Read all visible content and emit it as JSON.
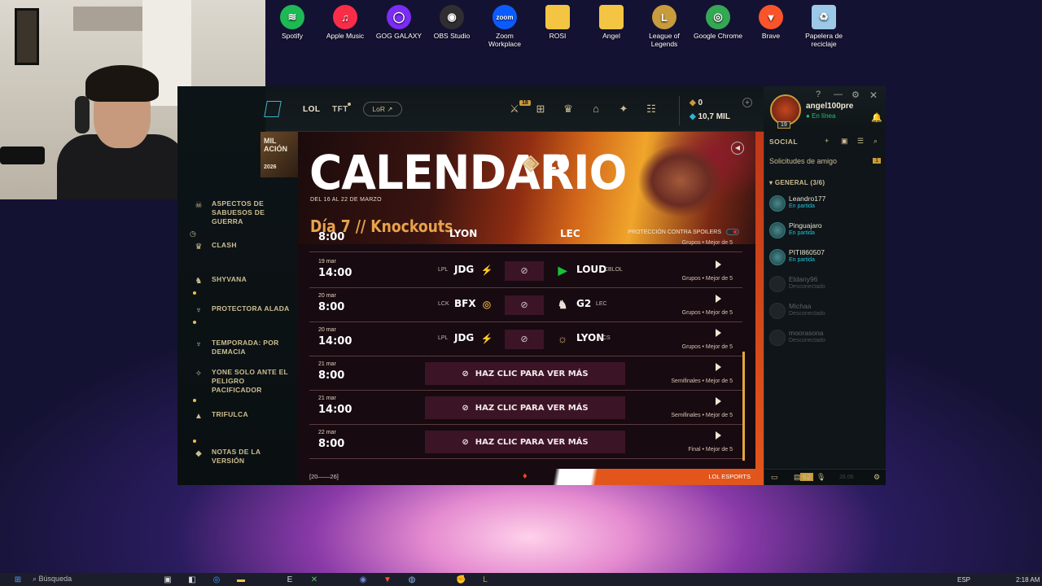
{
  "desktop_icons": [
    {
      "label": "Spotify",
      "icon": "spotify-icon",
      "color": "#1db954",
      "glyph": "≋"
    },
    {
      "label": "Apple Music",
      "icon": "apple-music-icon",
      "color": "#fa2d48",
      "glyph": "♫"
    },
    {
      "label": "GOG GALAXY",
      "icon": "gog-galaxy-icon",
      "color": "#7b2cf5",
      "glyph": "◯"
    },
    {
      "label": "OBS Studio",
      "icon": "obs-studio-icon",
      "color": "#302e31",
      "glyph": "◉"
    },
    {
      "label": "Zoom Workplace",
      "icon": "zoom-icon",
      "color": "#0b5cff",
      "glyph": "zoom"
    },
    {
      "label": "ROSI",
      "icon": "folder-icon",
      "color": "#f4c542",
      "glyph": ""
    },
    {
      "label": "Angel",
      "icon": "folder-icon",
      "color": "#f4c542",
      "glyph": ""
    },
    {
      "label": "League of\nLegends",
      "icon": "league-of-legends-icon",
      "color": "#c89b3c",
      "glyph": "L"
    },
    {
      "label": "Google Chrome",
      "icon": "chrome-icon",
      "color": "#34a853",
      "glyph": "◎"
    },
    {
      "label": "Brave",
      "icon": "brave-icon",
      "color": "#fb542b",
      "glyph": "▼"
    },
    {
      "label": "Papelera de\nreciclaje",
      "icon": "recycle-bin-icon",
      "color": "#9cc9e8",
      "glyph": "♻"
    }
  ],
  "topbar": {
    "lol": "LOL",
    "tft": "TFT",
    "lor": "LoR",
    "store_badge": "18",
    "rp": "0",
    "be": "10,7 MIL"
  },
  "profile": {
    "name": "angel100pre",
    "status": "En línea",
    "level": "19"
  },
  "left_nav": {
    "header_fragment": "MIL",
    "header_fragment2": "ACIÓN",
    "year": "2026",
    "items": [
      {
        "label": "ASPECTOS DE SABUESOS DE GUERRA",
        "icon": "skin-icon"
      },
      {
        "label": "CLASH",
        "icon": "clash-icon"
      },
      {
        "label": "SHYVANA",
        "icon": "champion-icon"
      },
      {
        "label": "PROTECTORA ALADA",
        "icon": "event-icon"
      },
      {
        "label": "TEMPORADA: POR DEMACIA",
        "icon": "season-icon"
      },
      {
        "label": "YONE SOLO ANTE EL PELIGRO PACIFICADOR",
        "icon": "yone-icon"
      },
      {
        "label": "TRIFULCA",
        "icon": "brawl-icon"
      },
      {
        "label": "NOTAS DE LA VERSIÓN",
        "icon": "patch-notes-icon"
      }
    ]
  },
  "hero": {
    "title": "CALENDARIO",
    "logo_text": "26",
    "dates": "DEL 16 AL 22 DE MARZO",
    "day_title": "Día 7 // Knockouts",
    "spoilers_label": "PROTECCIÓN CONTRA SPOILERS"
  },
  "schedule": {
    "partial_row": {
      "left": "LYON",
      "right": "LEC",
      "format": "Grupos • Mejor de 5",
      "time": "8:00"
    },
    "matches": [
      {
        "date": "19 mar",
        "time": "14:00",
        "league_left": "LPL",
        "team_left": "JDG",
        "team_right": "LOUD",
        "league_right": "CBLOL",
        "format": "Grupos • Mejor de 5"
      },
      {
        "date": "20 mar",
        "time": "8:00",
        "league_left": "LCK",
        "team_left": "BFX",
        "team_right": "G2",
        "league_right": "LEC",
        "format": "Grupos • Mejor de 5"
      },
      {
        "date": "20 mar",
        "time": "14:00",
        "league_left": "LPL",
        "team_left": "JDG",
        "team_right": "LYON",
        "league_right": "LCS",
        "format": "Grupos • Mejor de 5"
      }
    ],
    "hidden": [
      {
        "date": "21 mar",
        "time": "8:00",
        "cta": "HAZ CLIC PARA VER MÁS",
        "format": "Semifinales • Mejor de 5"
      },
      {
        "date": "21 mar",
        "time": "14:00",
        "cta": "HAZ CLIC PARA VER MÁS",
        "format": "Semifinales • Mejor de 5"
      },
      {
        "date": "22 mar",
        "time": "8:00",
        "cta": "HAZ CLIC PARA VER MÁS",
        "format": "Final • Mejor de 5"
      }
    ]
  },
  "footer": {
    "range": "[20——26]",
    "brand": "LOL ESPORTS"
  },
  "social": {
    "title": "SOCIAL",
    "requests": "Solicitudes de amigo",
    "requests_count": "1",
    "group": "GENERAL (3/6)",
    "friends": [
      {
        "name": "Leandro177",
        "status": "En partida",
        "online": true
      },
      {
        "name": "Pinguajaro",
        "status": "En partida",
        "online": true
      },
      {
        "name": "PITI860507",
        "status": "En partida",
        "online": true
      },
      {
        "name": "Eldany96",
        "status": "Desconectado",
        "online": false
      },
      {
        "name": "Michaa",
        "status": "Desconectado",
        "online": false
      },
      {
        "name": "moorasona",
        "status": "Desconectado",
        "online": false
      }
    ],
    "footer_badge": "62",
    "version": "26.06"
  },
  "taskbar": {
    "search": "Búsqueda",
    "lang": "ESP",
    "time": "2:18 AM"
  }
}
